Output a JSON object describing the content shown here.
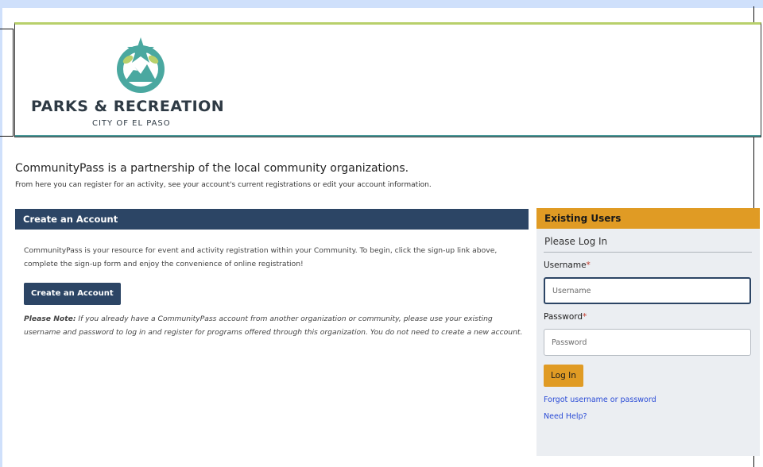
{
  "banner": {
    "title": "PARKS & RECREATION",
    "subtitle": "CITY OF EL PASO",
    "colors": {
      "teal": "#4aa8a0",
      "green": "#b8d06b",
      "navy": "#2e3a44"
    }
  },
  "intro": {
    "headline": "CommunityPass is a partnership of the local community organizations.",
    "subline": "From here you can register for an activity, see your account's current registrations or edit your account information."
  },
  "create_account": {
    "header": "Create an Account",
    "description": "CommunityPass is your resource for event and activity registration within your Community. To begin, click the sign-up link above, complete the sign-up form and enjoy the convenience of online registration!",
    "button_label": "Create an Account",
    "note_label": "Please Note:",
    "note_text": " If you already have a CommunityPass account from another organization or community, please use your existing username and password to log in and register for programs offered through this organization. You do not need to create a new account."
  },
  "login": {
    "header": "Existing Users",
    "subheader": "Please Log In",
    "username_label": "Username",
    "username_placeholder": "Username",
    "password_label": "Password",
    "password_placeholder": "Password",
    "required_mark": "*",
    "button_label": "Log In",
    "forgot_link": "Forgot username or password",
    "help_link": "Need Help?"
  },
  "colors": {
    "navy": "#2c4565",
    "gold": "#e09b24",
    "panel_bg": "#ebeef2",
    "link": "#2a4bd6"
  }
}
